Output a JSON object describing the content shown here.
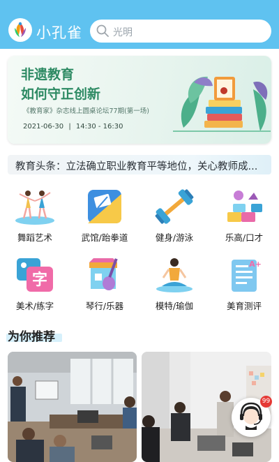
{
  "header": {
    "app_name": "小孔雀",
    "search_placeholder": "光明"
  },
  "banner": {
    "title_line1": "非遗教育",
    "title_line2": "如何守正创新",
    "subtitle": "《教育家》杂志线上圆桌论坛77期(第一场)",
    "date": "2021-06-30",
    "time": "14:30 - 16:30",
    "accent_color": "#2d8a63"
  },
  "headline": {
    "text": "教育头条：立法确立职业教育平等地位，关心教师成..."
  },
  "categories": [
    {
      "label": "舞蹈艺术",
      "icon": "dance-icon"
    },
    {
      "label": "武馆/跆拳道",
      "icon": "martial-arts-icon"
    },
    {
      "label": "健身/游泳",
      "icon": "dumbbell-icon"
    },
    {
      "label": "乐高/口才",
      "icon": "lego-blocks-icon"
    },
    {
      "label": "美术/练字",
      "icon": "calligraphy-icon"
    },
    {
      "label": "琴行/乐器",
      "icon": "guitar-shop-icon"
    },
    {
      "label": "模特/瑜伽",
      "icon": "yoga-icon"
    },
    {
      "label": "美育测评",
      "icon": "assessment-icon"
    }
  ],
  "recommend": {
    "title": "为你推荐",
    "cards": [
      {
        "name": "classroom-photo"
      },
      {
        "name": "office-photo"
      }
    ]
  },
  "service": {
    "badge_count": "99",
    "icon": "customer-service-icon"
  },
  "colors": {
    "header_bg": "#5fc2f0",
    "badge": "#e53935"
  }
}
